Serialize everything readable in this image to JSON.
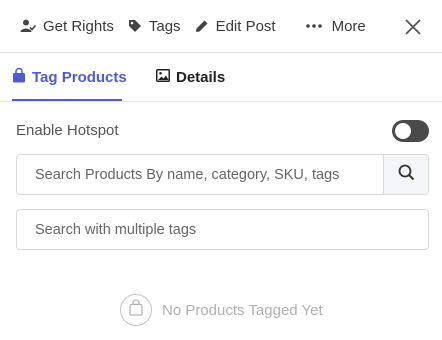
{
  "toolbar": {
    "get_rights": {
      "label": "Get Rights",
      "icon": "user-check-icon"
    },
    "tags": {
      "label": "Tags",
      "icon": "tag-icon"
    },
    "edit_post": {
      "label": "Edit Post",
      "icon": "pencil-icon"
    },
    "more": {
      "label": "More",
      "icon": "ellipsis-icon"
    },
    "close_icon": "close-icon"
  },
  "tabs": [
    {
      "label": "Tag Products",
      "icon": "shopping-bag-icon",
      "active": true
    },
    {
      "label": "Details",
      "icon": "image-icon",
      "active": false
    }
  ],
  "hotspot": {
    "label": "Enable Hotspot",
    "enabled": false
  },
  "search": {
    "placeholder": "Search Products By name, category, SKU, tags",
    "icon": "search-icon"
  },
  "tag_search": {
    "placeholder": "Search with multiple tags"
  },
  "empty_state": {
    "text": "No Products Tagged Yet",
    "icon": "shopping-bag-outline-icon"
  },
  "colors": {
    "accent": "#4f5bd5",
    "toggle_off": "#4a4a4a",
    "muted_text": "#b0b0b0"
  }
}
